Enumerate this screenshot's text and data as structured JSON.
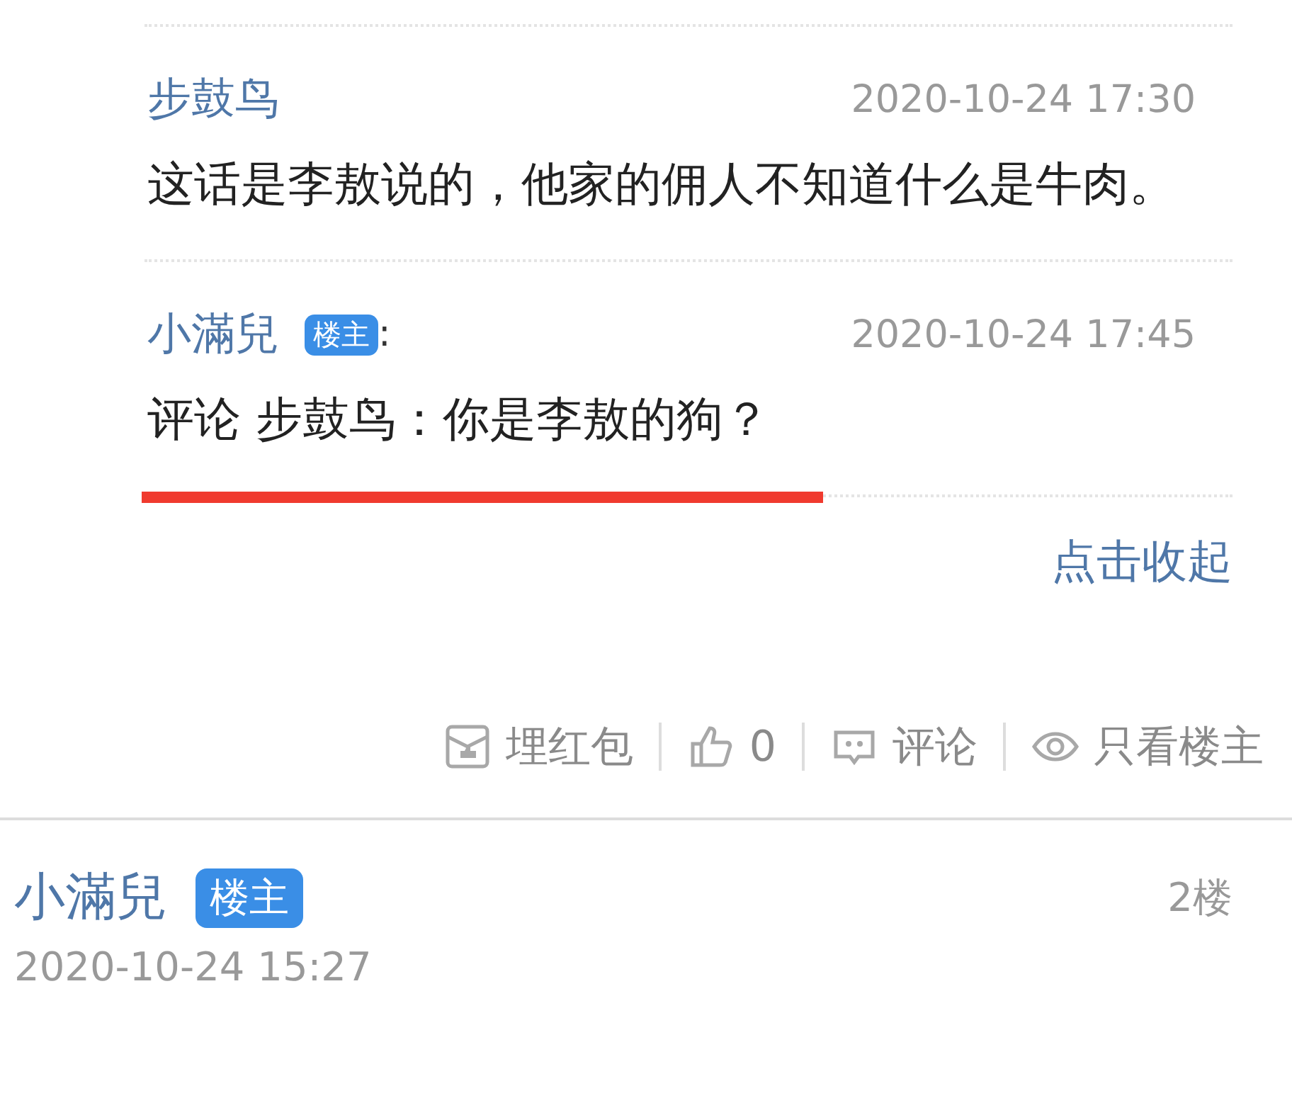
{
  "replies": [
    {
      "author": "步鼓鸟",
      "time": "2020-10-24 17:30",
      "text": "这话是李敖说的，他家的佣人不知道什么是牛肉。",
      "underlined": false
    },
    {
      "author": "小滿兒",
      "badge": "楼主",
      "suffix": ":",
      "time": "2020-10-24 17:45",
      "text": "评论 步鼓鸟：你是李敖的狗？",
      "underlined": true
    }
  ],
  "collapse_link": "点击收起",
  "actions": [
    {
      "kind": "redpacket",
      "label": "埋红包"
    },
    {
      "kind": "like",
      "label": "0"
    },
    {
      "kind": "comment",
      "label": "评论"
    },
    {
      "kind": "eye",
      "label": "只看楼主"
    }
  ],
  "next_post": {
    "author": "小滿兒",
    "badge": "楼主",
    "floor": "2楼",
    "time": "2020-10-24 15:27"
  }
}
